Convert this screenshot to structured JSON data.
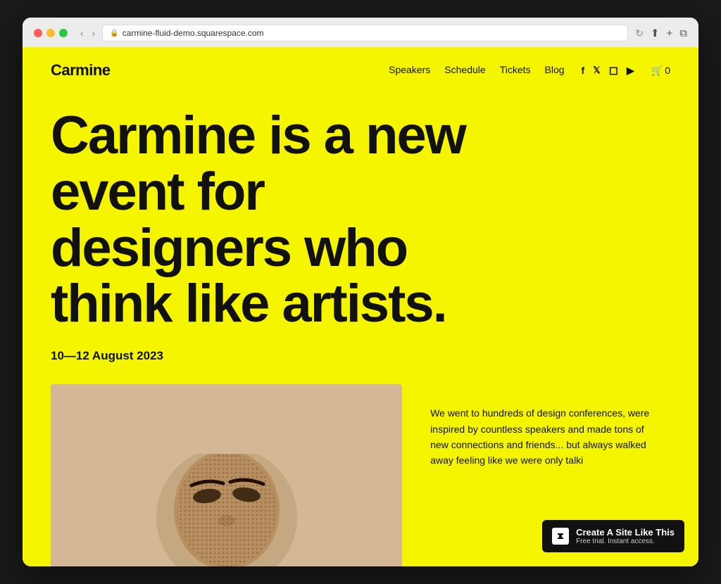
{
  "browser": {
    "url": "carmine-fluid-demo.squarespace.com",
    "reload_label": "↻"
  },
  "site": {
    "logo": "Carmine",
    "nav": {
      "links": [
        {
          "label": "Speakers",
          "href": "#"
        },
        {
          "label": "Schedule",
          "href": "#"
        },
        {
          "label": "Tickets",
          "href": "#"
        },
        {
          "label": "Blog",
          "href": "#"
        }
      ],
      "social": [
        {
          "label": "f",
          "name": "facebook"
        },
        {
          "label": "𝕏",
          "name": "twitter"
        },
        {
          "label": "◻",
          "name": "instagram"
        },
        {
          "label": "▶",
          "name": "youtube"
        }
      ],
      "cart_count": "0"
    },
    "hero": {
      "headline": "Carmine is a new event for designers who think like artists.",
      "date": "10—12 August 2023"
    },
    "description": "We went to hundreds of design conferences, were inspired by countless speakers and made tons of new connections and friends... but always walked away feeling like we were only talki"
  },
  "badge": {
    "title": "Create A Site Like This",
    "subtitle": "Free trial. Instant access.",
    "logo_symbol": "◈"
  }
}
